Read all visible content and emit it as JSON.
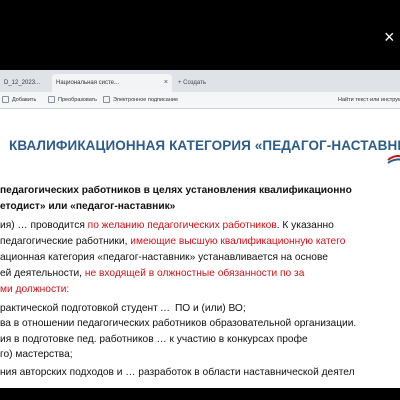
{
  "window": {
    "close_glyph": "×"
  },
  "tabs": [
    {
      "label": "D_12_2023..."
    },
    {
      "label": "Национальная систе...",
      "close": "×"
    },
    {
      "label": "+ Создать"
    }
  ],
  "toolbar": {
    "items": [
      "Добавить",
      "Преобразовать",
      "Электронное подписание"
    ],
    "right": "Найти текст или инструм"
  },
  "document": {
    "title": "КВАЛИФИКАЦИОННАЯ КАТЕГОРИЯ «ПЕДАГОГ-НАСТАВНИК",
    "lines": [
      {
        "parts": [
          {
            "t": " педагогических работников в целях установления квалификационно",
            "b": true
          }
        ]
      },
      {
        "parts": [
          {
            "t": "етодист» или «педагог-наставник»",
            "b": true
          }
        ]
      },
      {
        "parts": [
          {
            "t": "ия) … проводится "
          },
          {
            "t": "по желанию педагогических работников",
            "r": true
          },
          {
            "t": ". К указанно"
          }
        ]
      },
      {
        "parts": [
          {
            "t": " педагогические работники, "
          },
          {
            "t": "имеющие высшую квалификационную катего",
            "r": true
          }
        ]
      },
      {
        "parts": [
          {
            "t": "ационная  категория  «педагог-наставник»  устанавливается  на  основе"
          }
        ]
      },
      {
        "parts": [
          {
            "t": "ей  деятельности, "
          },
          {
            "t": "не  входящей  в",
            "r": true
          },
          {
            "t": "   "
          },
          {
            "t": "олжностные  обязанности  по  за",
            "r": true
          }
        ]
      },
      {
        "parts": [
          {
            "t": "ми должности:",
            "r": true
          }
        ]
      },
      {
        "parts": [
          {
            "t": "рактической подготовкой студент …  ПО и (или) ВО;"
          }
        ]
      },
      {
        "parts": [
          {
            "t": "ва в отношении педагогических работников образовательной организации."
          }
        ]
      },
      {
        "parts": [
          {
            "t": "ия  в  подготовке  пед.  работников  …  к  участию  в  конкурсах  профе"
          }
        ]
      },
      {
        "parts": [
          {
            "t": "го) мастерства;"
          }
        ]
      },
      {
        "parts": [
          {
            "t": "ния авторских подходов и … разработок в области наставнической деятел"
          }
        ]
      }
    ]
  }
}
